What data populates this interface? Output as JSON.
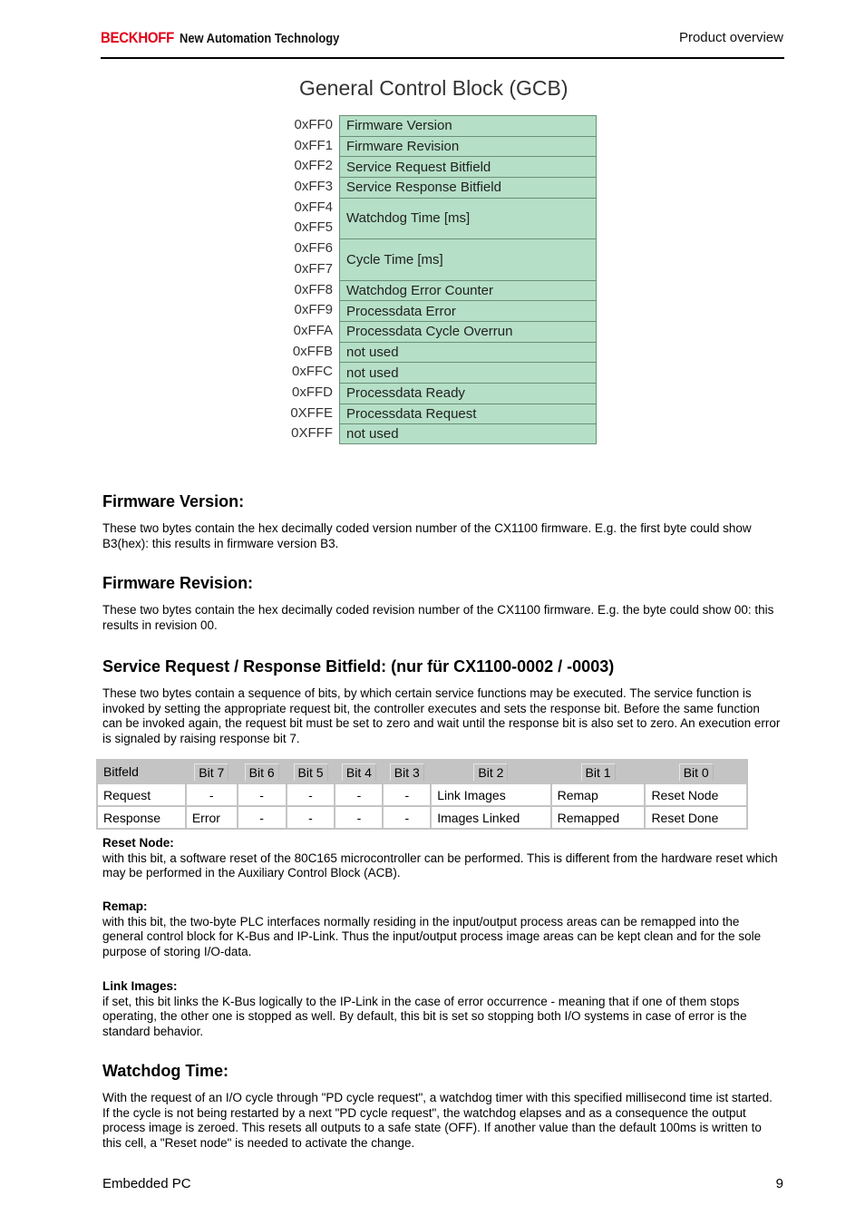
{
  "header": {
    "brand": "BECKHOFF",
    "tagline": "New Automation Technology",
    "section": "Product overview"
  },
  "gcb": {
    "title": "General Control Block (GCB)",
    "rows": [
      {
        "addresses": [
          "0xFF0"
        ],
        "label": "Firmware Version"
      },
      {
        "addresses": [
          "0xFF1"
        ],
        "label": "Firmware Revision"
      },
      {
        "addresses": [
          "0xFF2"
        ],
        "label": "Service Request Bitfield"
      },
      {
        "addresses": [
          "0xFF3"
        ],
        "label": "Service Response Bitfield"
      },
      {
        "addresses": [
          "0xFF4",
          "0xFF5"
        ],
        "label": "Watchdog Time [ms]"
      },
      {
        "addresses": [
          "0xFF6",
          "0xFF7"
        ],
        "label": "Cycle Time [ms]"
      },
      {
        "addresses": [
          "0xFF8"
        ],
        "label": "Watchdog Error Counter"
      },
      {
        "addresses": [
          "0xFF9"
        ],
        "label": "Processdata Error"
      },
      {
        "addresses": [
          "0xFFA"
        ],
        "label": "Processdata Cycle Overrun"
      },
      {
        "addresses": [
          "0xFFB"
        ],
        "label": "not used"
      },
      {
        "addresses": [
          "0xFFC"
        ],
        "label": "not used"
      },
      {
        "addresses": [
          "0xFFD"
        ],
        "label": "Processdata Ready"
      },
      {
        "addresses": [
          "0XFFE"
        ],
        "label": "Processdata Request"
      },
      {
        "addresses": [
          "0XFFF"
        ],
        "label": "not used"
      }
    ],
    "cell_color": "#b5dfc6"
  },
  "sections": {
    "firmware_version": {
      "heading": "Firmware Version:",
      "text": "These two bytes contain the hex decimally coded version number of the CX1100 firmware. E.g. the first byte could show B3(hex): this results in firmware version B3."
    },
    "firmware_revision": {
      "heading": "Firmware Revision:",
      "text": "These two bytes contain the hex decimally coded revision number of the CX1100 firmware. E.g. the byte could show 00: this results in revision 00."
    },
    "service_bitfield": {
      "heading": "Service Request / Response Bitfield: (nur für CX1100-0002 / -0003)",
      "text": "These two bytes contain a sequence of bits, by which certain service functions may be executed. The service function is invoked by setting the appropriate request bit, the controller executes and sets the response bit. Before the same function can be invoked again, the request bit must be set to zero and wait until the response bit is also set to zero. An execution error is signaled by raising response bit 7."
    },
    "reset_node": {
      "heading": "Reset Node:",
      "text": "with this bit, a software reset of the 80C165 microcontroller can be performed. This is different from the hardware reset which may be performed in the Auxiliary Control Block (ACB)."
    },
    "remap": {
      "heading": "Remap:",
      "text": "with this bit, the two-byte PLC interfaces normally residing in the input/output process areas can be remapped into the general control block for K-Bus and IP-Link. Thus the input/output process image areas can be kept clean and for the sole purpose of storing I/O-data."
    },
    "link_images": {
      "heading": "Link Images:",
      "text": "if set, this bit links the K-Bus logically to the IP-Link in the case of error occurrence - meaning that if one of them stops operating, the other one is stopped as well. By default, this bit is set so stopping both I/O systems in case of error is the standard behavior."
    },
    "watchdog_time": {
      "heading": "Watchdog Time:",
      "text": "With the request of an I/O cycle through \"PD cycle request\", a watchdog timer with this specified millisecond time ist started. If the cycle is not being restarted by a next \"PD cycle request\", the watchdog elapses and as a consequence the output process image is zeroed. This resets all outputs to a safe state (OFF). If another value than the default 100ms is written to this cell, a \"Reset node\" is needed to activate the change."
    }
  },
  "bit_table": {
    "headers": [
      "Bitfeld",
      "Bit 7",
      "Bit 6",
      "Bit 5",
      "Bit 4",
      "Bit 3",
      "Bit 2",
      "Bit 1",
      "Bit 0"
    ],
    "rows": [
      [
        "Request",
        "-",
        "-",
        "-",
        "-",
        "-",
        "Link Images",
        "Remap",
        "Reset Node"
      ],
      [
        "Response",
        "Error",
        "-",
        "-",
        "-",
        "-",
        "Images Linked",
        "Remapped",
        "Reset Done"
      ]
    ]
  },
  "footer": {
    "left": "Embedded PC",
    "page": "9"
  }
}
